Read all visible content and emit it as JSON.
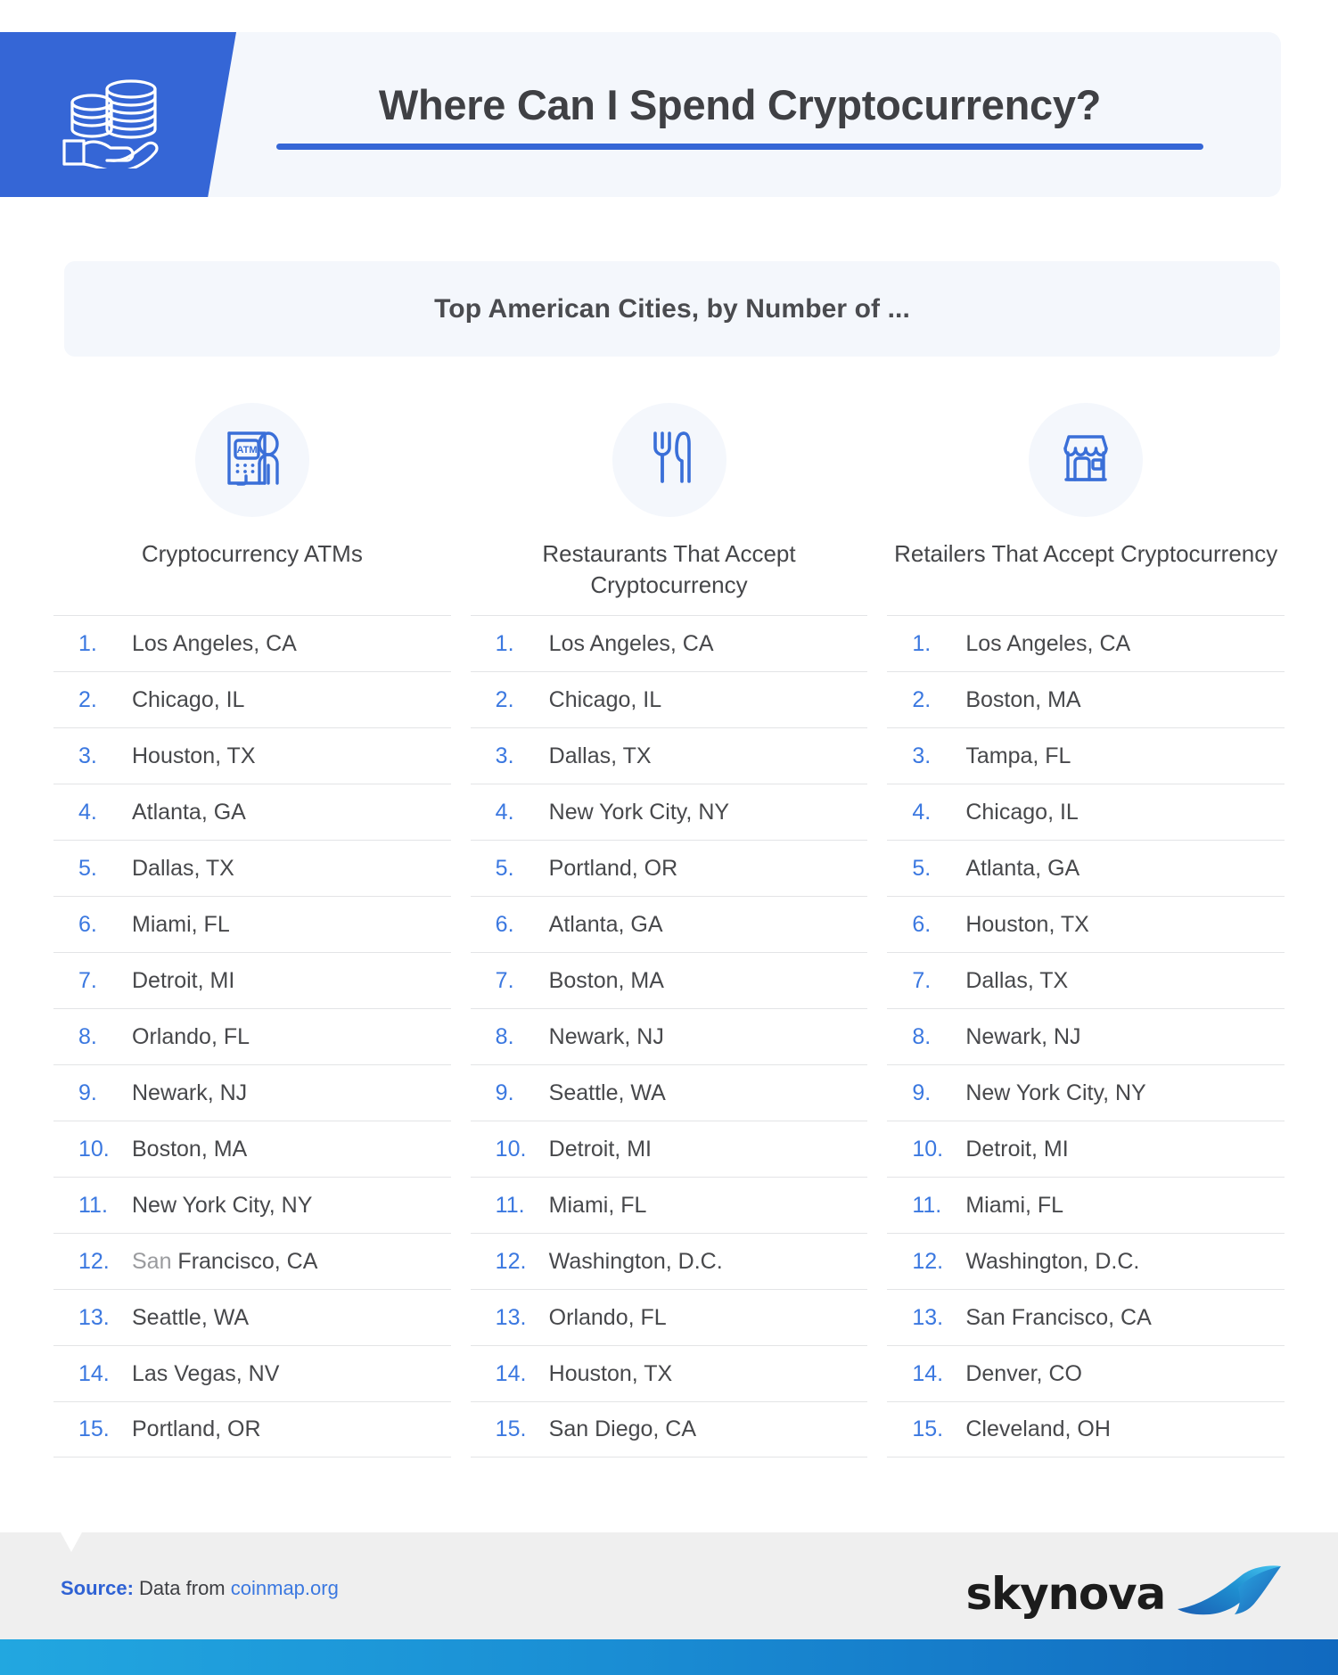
{
  "header": {
    "title": "Where Can I Spend Cryptocurrency?",
    "icon": "coins-in-hand-icon",
    "accent_color": "#3566d6",
    "band_color": "#f4f7fc"
  },
  "subtitle": {
    "text": "Top American Cities, by Number of ..."
  },
  "columns": [
    {
      "icon": "atm-machine-icon",
      "heading": "Cryptocurrency ATMs",
      "items": [
        {
          "rank": "1.",
          "city": "Los Angeles, CA"
        },
        {
          "rank": "2.",
          "city": "Chicago, IL"
        },
        {
          "rank": "3.",
          "city": "Houston, TX"
        },
        {
          "rank": "4.",
          "city": "Atlanta, GA"
        },
        {
          "rank": "5.",
          "city": "Dallas, TX"
        },
        {
          "rank": "6.",
          "city": "Miami, FL"
        },
        {
          "rank": "7.",
          "city": "Detroit, MI"
        },
        {
          "rank": "8.",
          "city": "Orlando, FL"
        },
        {
          "rank": "9.",
          "city": "Newark, NJ"
        },
        {
          "rank": "10.",
          "city": "Boston, MA"
        },
        {
          "rank": "11.",
          "city": "New York City, NY"
        },
        {
          "rank": "12.",
          "city": "San Francisco, CA"
        },
        {
          "rank": "13.",
          "city": "Seattle, WA"
        },
        {
          "rank": "14.",
          "city": "Las Vegas, NV"
        },
        {
          "rank": "15.",
          "city": "Portland, OR"
        }
      ]
    },
    {
      "icon": "fork-and-knife-icon",
      "heading": "Restaurants That Accept Cryptocurrency",
      "items": [
        {
          "rank": "1.",
          "city": "Los Angeles, CA"
        },
        {
          "rank": "2.",
          "city": "Chicago, IL"
        },
        {
          "rank": "3.",
          "city": "Dallas, TX"
        },
        {
          "rank": "4.",
          "city": "New York City, NY"
        },
        {
          "rank": "5.",
          "city": "Portland, OR"
        },
        {
          "rank": "6.",
          "city": "Atlanta, GA"
        },
        {
          "rank": "7.",
          "city": "Boston, MA"
        },
        {
          "rank": "8.",
          "city": "Newark, NJ"
        },
        {
          "rank": "9.",
          "city": "Seattle, WA"
        },
        {
          "rank": "10.",
          "city": "Detroit, MI"
        },
        {
          "rank": "11.",
          "city": "Miami, FL"
        },
        {
          "rank": "12.",
          "city": "Washington, D.C."
        },
        {
          "rank": "13.",
          "city": "Orlando, FL"
        },
        {
          "rank": "14.",
          "city": "Houston, TX"
        },
        {
          "rank": "15.",
          "city": "San Diego, CA"
        }
      ]
    },
    {
      "icon": "storefront-icon",
      "heading": "Retailers That Accept Cryptocurrency",
      "items": [
        {
          "rank": "1.",
          "city": "Los Angeles, CA"
        },
        {
          "rank": "2.",
          "city": "Boston, MA"
        },
        {
          "rank": "3.",
          "city": "Tampa, FL"
        },
        {
          "rank": "4.",
          "city": "Chicago, IL"
        },
        {
          "rank": "5.",
          "city": "Atlanta, GA"
        },
        {
          "rank": "6.",
          "city": "Houston, TX"
        },
        {
          "rank": "7.",
          "city": "Dallas, TX"
        },
        {
          "rank": "8.",
          "city": "Newark, NJ"
        },
        {
          "rank": "9.",
          "city": "New York City, NY"
        },
        {
          "rank": "10.",
          "city": "Detroit, MI"
        },
        {
          "rank": "11.",
          "city": "Miami, FL"
        },
        {
          "rank": "12.",
          "city": "Washington, D.C."
        },
        {
          "rank": "13.",
          "city": "San Francisco, CA"
        },
        {
          "rank": "14.",
          "city": "Denver, CO"
        },
        {
          "rank": "15.",
          "city": "Cleveland, OH"
        }
      ]
    }
  ],
  "footer": {
    "source_label": "Source:",
    "source_text": "Data from",
    "source_link": "coinmap.org",
    "logo_text": "skynova",
    "logo_mark": "wave-swoosh-icon"
  }
}
